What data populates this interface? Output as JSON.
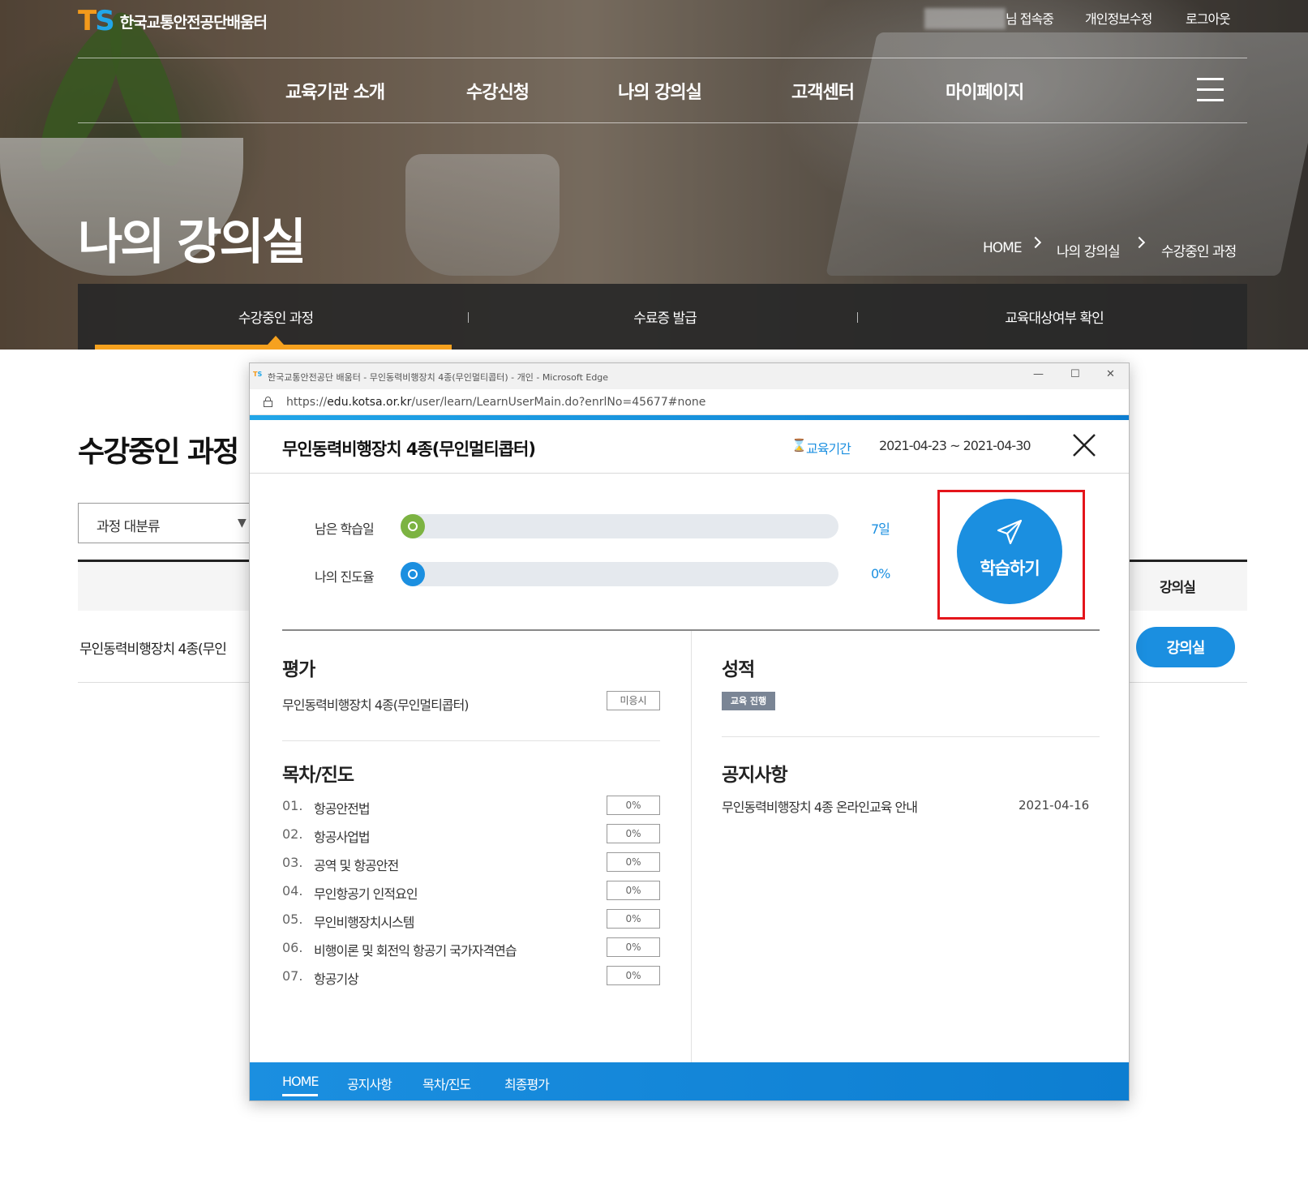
{
  "header": {
    "logo_mark_t": "T",
    "logo_mark_s": "S",
    "site_name": "한국교통안전공단배움터",
    "utility": {
      "login_status": "님 접속중",
      "edit_profile": "개인정보수정",
      "logout": "로그아웃"
    },
    "gnb": [
      "교육기관 소개",
      "수강신청",
      "나의 강의실",
      "고객센터",
      "마이페이지"
    ]
  },
  "hero": {
    "page_title": "나의 강의실",
    "breadcrumb": [
      "HOME",
      "나의 강의실",
      "수강중인 과정"
    ]
  },
  "subnav": {
    "items": [
      "수강중인 과정",
      "수료증 발급",
      "교육대상여부 확인"
    ],
    "active_index": 0
  },
  "main": {
    "section_title": "수강중인 과정",
    "category_select": "과정 대분류",
    "table_header_room": "강의실",
    "row_course": "무인동력비행장치 4종(무인",
    "row_room_button": "강의실"
  },
  "popup": {
    "window_title": "한국교통안전공단 배움터 - 무인동력비행장치 4종(무인멀티콥터) - 개인 - Microsoft Edge",
    "favicon_t": "T",
    "favicon_s": "S",
    "url_prefix": "https://",
    "url_host": "edu.kotsa.or.kr",
    "url_path": "/user/learn/LearnUserMain.do?enrlNo=45677#none",
    "course_title": "무인동력비행장치 4종(무인멀티콥터)",
    "period_label": "교육기간",
    "period_value": "2021-04-23 ~ 2021-04-30",
    "progress": [
      {
        "label": "남은 학습일",
        "value": "7일",
        "color": "#7cb342"
      },
      {
        "label": "나의 진도율",
        "value": "0%",
        "color": "#1b8fe0"
      }
    ],
    "learn_button": "학습하기",
    "evaluation": {
      "title": "평가",
      "item_name": "무인동력비행장치 4종(무인멀티콥터)",
      "item_status": "미응시"
    },
    "toc": {
      "title": "목차/진도",
      "items": [
        {
          "num": "01.",
          "name": "항공안전법",
          "pct": "0%"
        },
        {
          "num": "02.",
          "name": "항공사업법",
          "pct": "0%"
        },
        {
          "num": "03.",
          "name": "공역 및 항공안전",
          "pct": "0%"
        },
        {
          "num": "04.",
          "name": "무인항공기 인적요인",
          "pct": "0%"
        },
        {
          "num": "05.",
          "name": "무인비행장치시스템",
          "pct": "0%"
        },
        {
          "num": "06.",
          "name": "비행이론 및 회전익 항공기 국가자격연습",
          "pct": "0%"
        },
        {
          "num": "07.",
          "name": "항공기상",
          "pct": "0%"
        }
      ]
    },
    "grade": {
      "title": "성적",
      "badge": "교육 진행"
    },
    "notice": {
      "title": "공지사항",
      "item_title": "무인동력비행장치 4종 온라인교육 안내",
      "item_date": "2021-04-16"
    },
    "footer_tabs": [
      "HOME",
      "공지사항",
      "목차/진도",
      "최종평가"
    ],
    "colors": {
      "accent": "#1b8fe0",
      "highlight_box": "#e4151b",
      "active_tab": "#f6a11e"
    }
  }
}
